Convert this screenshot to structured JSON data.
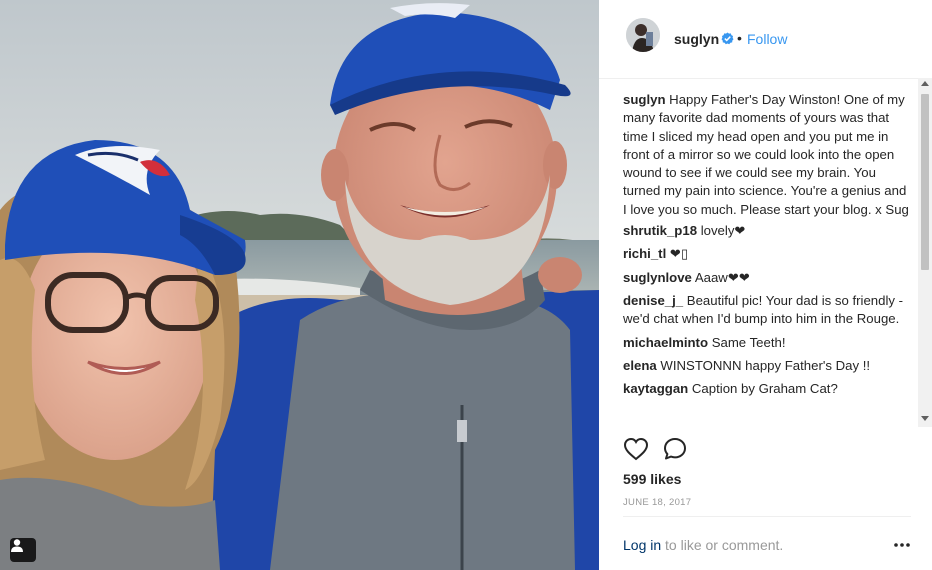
{
  "photo": {
    "alt_icons": [
      "user-tag-icon"
    ]
  },
  "header": {
    "username": "suglyn",
    "separator": "•",
    "follow_label": "Follow",
    "verified_color": "#3897f0"
  },
  "caption": {
    "username": "suglyn",
    "text": "Happy Father's Day Winston! One of my many favorite dad moments of yours was that time I sliced my head open and you put me in front of a mirror so we could look into the open wound to see if we could see my brain. You turned my pain into science. You're a genius and I love you so much. Please start your blog. x Sug"
  },
  "comments": [
    {
      "username": "shrutik_p18",
      "text": "lovely❤"
    },
    {
      "username": "richi_tl",
      "text": "❤▯"
    },
    {
      "username": "suglynlove",
      "text": "Aaaw❤❤"
    },
    {
      "username": "denise_j_",
      "text": "Beautiful pic! Your dad is so friendly - we'd chat when I'd bump into him in the Rouge."
    },
    {
      "username": "michaelminto",
      "text": "Same Teeth!"
    },
    {
      "username": "elena",
      "text": "WINSTONNN happy Father's Day !!"
    },
    {
      "username": "kaytaggan",
      "text": "Caption by Graham Cat?"
    }
  ],
  "stats": {
    "likes": "599 likes",
    "date": "JUNE 18, 2017"
  },
  "footer": {
    "login_link": "Log in",
    "login_rest": " to like or comment."
  },
  "colors": {
    "link_blue": "#3897f0",
    "login_blue": "#003569",
    "muted": "#999999"
  }
}
